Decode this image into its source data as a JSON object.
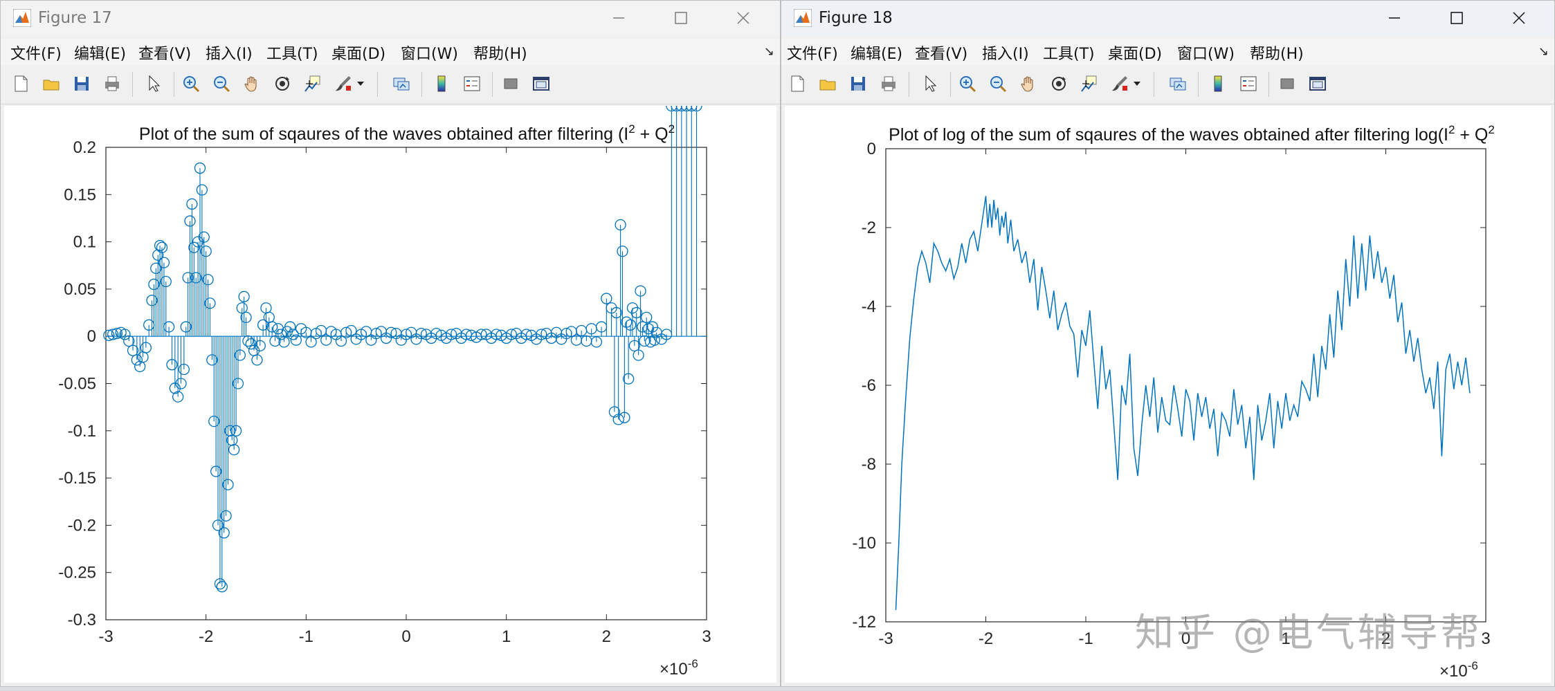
{
  "figure17": {
    "title": "Figure 17",
    "menu": [
      "文件(F)",
      "编辑(E)",
      "查看(V)",
      "插入(I)",
      "工具(T)",
      "桌面(D)",
      "窗口(W)",
      "帮助(H)"
    ],
    "chart_data": {
      "type": "stem",
      "title_main": "Plot of the sum of sqaures of the waves obtained after filtering (I",
      "title_sup1": "2",
      "title_mid": " + Q",
      "title_sup2": "2",
      "xlim": [
        -3,
        3
      ],
      "ylim": [
        -0.3,
        0.2
      ],
      "xticks": [
        "-3",
        "-2",
        "-1",
        "0",
        "1",
        "2",
        "3"
      ],
      "yticks": [
        "0.2",
        "0.15",
        "0.1",
        "0.05",
        "0",
        "-0.05",
        "-0.1",
        "-0.15",
        "-0.2",
        "-0.25",
        "-0.3"
      ],
      "x_exponent_base": "×10",
      "x_exponent": "-6",
      "series_color": "#0072bd",
      "x": [
        -2.97,
        -2.93,
        -2.89,
        -2.85,
        -2.81,
        -2.77,
        -2.73,
        -2.69,
        -2.66,
        -2.63,
        -2.6,
        -2.57,
        -2.54,
        -2.52,
        -2.5,
        -2.48,
        -2.46,
        -2.44,
        -2.42,
        -2.4,
        -2.37,
        -2.34,
        -2.31,
        -2.28,
        -2.25,
        -2.22,
        -2.2,
        -2.18,
        -2.16,
        -2.14,
        -2.12,
        -2.1,
        -2.08,
        -2.06,
        -2.04,
        -2.02,
        -2.0,
        -1.98,
        -1.96,
        -1.94,
        -1.92,
        -1.9,
        -1.88,
        -1.86,
        -1.84,
        -1.82,
        -1.8,
        -1.78,
        -1.76,
        -1.74,
        -1.72,
        -1.7,
        -1.68,
        -1.66,
        -1.64,
        -1.62,
        -1.6,
        -1.58,
        -1.55,
        -1.52,
        -1.49,
        -1.46,
        -1.43,
        -1.4,
        -1.37,
        -1.34,
        -1.31,
        -1.28,
        -1.25,
        -1.22,
        -1.19,
        -1.16,
        -1.13,
        -1.1,
        -1.05,
        -1.0,
        -0.95,
        -0.9,
        -0.85,
        -0.8,
        -0.75,
        -0.7,
        -0.65,
        -0.6,
        -0.55,
        -0.5,
        -0.45,
        -0.4,
        -0.35,
        -0.3,
        -0.25,
        -0.2,
        -0.15,
        -0.1,
        -0.05,
        0.0,
        0.05,
        0.1,
        0.15,
        0.2,
        0.25,
        0.3,
        0.35,
        0.4,
        0.45,
        0.5,
        0.55,
        0.6,
        0.65,
        0.7,
        0.75,
        0.8,
        0.85,
        0.9,
        0.95,
        1.0,
        1.05,
        1.1,
        1.15,
        1.2,
        1.25,
        1.3,
        1.35,
        1.4,
        1.45,
        1.5,
        1.55,
        1.6,
        1.65,
        1.7,
        1.75,
        1.8,
        1.85,
        1.9,
        1.95,
        2.0,
        2.05,
        2.08,
        2.1,
        2.12,
        2.14,
        2.16,
        2.18,
        2.2,
        2.22,
        2.24,
        2.26,
        2.28,
        2.3,
        2.32,
        2.34,
        2.36,
        2.38,
        2.4,
        2.42,
        2.44,
        2.46,
        2.48,
        2.5,
        2.55,
        2.6,
        2.65,
        2.7,
        2.75,
        2.8,
        2.85,
        2.9
      ],
      "y": [
        0.001,
        0.002,
        0.003,
        0.004,
        0.002,
        -0.005,
        -0.015,
        -0.025,
        -0.032,
        -0.022,
        -0.012,
        0.012,
        0.038,
        0.055,
        0.072,
        0.086,
        0.096,
        0.094,
        0.078,
        0.058,
        0.01,
        -0.03,
        -0.055,
        -0.064,
        -0.05,
        -0.035,
        0.01,
        0.062,
        0.122,
        0.14,
        0.094,
        0.062,
        0.1,
        0.178,
        0.155,
        0.105,
        0.09,
        0.06,
        0.035,
        -0.025,
        -0.09,
        -0.143,
        -0.2,
        -0.262,
        -0.265,
        -0.208,
        -0.19,
        -0.157,
        -0.1,
        -0.11,
        -0.12,
        -0.1,
        -0.05,
        -0.02,
        0.03,
        0.042,
        0.02,
        -0.005,
        -0.008,
        -0.015,
        -0.025,
        -0.01,
        0.012,
        0.03,
        0.02,
        0.01,
        -0.005,
        0.008,
        0.002,
        -0.006,
        0.005,
        0.01,
        0.002,
        -0.004,
        0.008,
        0.004,
        -0.006,
        0.003,
        0.006,
        -0.004,
        0.005,
        0.002,
        -0.005,
        0.004,
        0.006,
        -0.003,
        0.002,
        0.005,
        -0.004,
        0.003,
        0.005,
        -0.002,
        0.004,
        0.003,
        -0.004,
        0.002,
        0.004,
        -0.003,
        0.003,
        0.002,
        -0.002,
        0.003,
        0.001,
        -0.002,
        0.002,
        0.003,
        -0.002,
        0.002,
        0.001,
        -0.001,
        0.002,
        0.002,
        -0.002,
        0.002,
        0.001,
        -0.002,
        0.002,
        0.003,
        -0.002,
        0.002,
        0.001,
        -0.003,
        0.002,
        0.003,
        -0.002,
        0.004,
        -0.003,
        0.003,
        0.005,
        -0.004,
        0.006,
        -0.005,
        0.008,
        -0.006,
        0.01,
        0.04,
        0.03,
        -0.08,
        0.025,
        -0.088,
        0.118,
        0.09,
        -0.086,
        0.015,
        -0.045,
        0.012,
        0.03,
        -0.01,
        0.025,
        -0.02,
        0.048,
        0.01,
        -0.005,
        0.02,
        0.008,
        -0.006,
        0.01,
        -0.004,
        0.004,
        -0.003,
        0.002
      ],
      "y_axis_values": [
        0.2,
        0.15,
        0.1,
        0.05,
        0,
        -0.05,
        -0.1,
        -0.15,
        -0.2,
        -0.25,
        -0.3
      ],
      "x_axis_values": [
        -3,
        -2,
        -1,
        0,
        1,
        2,
        3
      ]
    }
  },
  "figure18": {
    "title": "Figure 18",
    "menu": [
      "文件(F)",
      "编辑(E)",
      "查看(V)",
      "插入(I)",
      "工具(T)",
      "桌面(D)",
      "窗口(W)",
      "帮助(H)"
    ],
    "chart_data": {
      "type": "line",
      "title_main": "Plot of log of the sum of sqaures of the waves obtained after filtering log(I",
      "title_sup1": "2",
      "title_mid": " + Q",
      "title_sup2": "2",
      "xlim": [
        -3,
        3
      ],
      "ylim": [
        -12,
        0
      ],
      "xticks": [
        "-3",
        "-2",
        "-1",
        "0",
        "1",
        "2",
        "3"
      ],
      "yticks": [
        "0",
        "-2",
        "-4",
        "-6",
        "-8",
        "-10",
        "-12"
      ],
      "x_exponent_base": "×10",
      "x_exponent": "-6",
      "series_color": "#0072bd",
      "x": [
        -2.9,
        -2.87,
        -2.84,
        -2.8,
        -2.76,
        -2.72,
        -2.68,
        -2.64,
        -2.6,
        -2.56,
        -2.52,
        -2.48,
        -2.44,
        -2.4,
        -2.36,
        -2.32,
        -2.28,
        -2.24,
        -2.2,
        -2.16,
        -2.12,
        -2.08,
        -2.04,
        -2.0,
        -1.98,
        -1.96,
        -1.94,
        -1.92,
        -1.9,
        -1.88,
        -1.86,
        -1.84,
        -1.82,
        -1.8,
        -1.78,
        -1.75,
        -1.72,
        -1.68,
        -1.64,
        -1.6,
        -1.56,
        -1.52,
        -1.48,
        -1.44,
        -1.4,
        -1.36,
        -1.32,
        -1.28,
        -1.24,
        -1.2,
        -1.16,
        -1.12,
        -1.08,
        -1.04,
        -1.0,
        -0.96,
        -0.92,
        -0.88,
        -0.84,
        -0.8,
        -0.76,
        -0.72,
        -0.68,
        -0.64,
        -0.6,
        -0.56,
        -0.52,
        -0.48,
        -0.44,
        -0.4,
        -0.36,
        -0.32,
        -0.28,
        -0.24,
        -0.2,
        -0.16,
        -0.12,
        -0.08,
        -0.04,
        0.0,
        0.04,
        0.08,
        0.12,
        0.16,
        0.2,
        0.24,
        0.28,
        0.32,
        0.36,
        0.4,
        0.44,
        0.48,
        0.52,
        0.56,
        0.6,
        0.64,
        0.68,
        0.72,
        0.76,
        0.8,
        0.84,
        0.88,
        0.92,
        0.96,
        1.0,
        1.04,
        1.08,
        1.12,
        1.16,
        1.2,
        1.24,
        1.28,
        1.32,
        1.36,
        1.4,
        1.44,
        1.48,
        1.52,
        1.56,
        1.6,
        1.64,
        1.68,
        1.72,
        1.76,
        1.8,
        1.84,
        1.88,
        1.92,
        1.96,
        2.0,
        2.04,
        2.08,
        2.12,
        2.16,
        2.2,
        2.24,
        2.28,
        2.32,
        2.36,
        2.4,
        2.44,
        2.48,
        2.52,
        2.56,
        2.6,
        2.64,
        2.68,
        2.72,
        2.76,
        2.8,
        2.84,
        2.88,
        2.92,
        2.96
      ],
      "y": [
        -11.7,
        -10.0,
        -8.0,
        -6.3,
        -4.8,
        -3.8,
        -3.0,
        -2.6,
        -2.9,
        -3.4,
        -2.4,
        -2.6,
        -2.9,
        -3.1,
        -2.8,
        -3.3,
        -3.0,
        -2.4,
        -2.9,
        -2.3,
        -2.1,
        -2.6,
        -1.9,
        -1.2,
        -2.0,
        -1.4,
        -2.0,
        -1.3,
        -1.8,
        -1.5,
        -2.2,
        -1.7,
        -2.0,
        -1.6,
        -2.4,
        -1.8,
        -2.6,
        -2.3,
        -2.9,
        -2.6,
        -3.4,
        -2.8,
        -4.1,
        -3.0,
        -3.6,
        -4.3,
        -3.6,
        -4.6,
        -4.2,
        -3.9,
        -4.5,
        -4.7,
        -5.8,
        -4.6,
        -5.0,
        -4.1,
        -5.4,
        -6.6,
        -5.0,
        -6.1,
        -5.6,
        -7.0,
        -8.4,
        -6.0,
        -6.5,
        -5.2,
        -7.6,
        -8.3,
        -7.0,
        -6.0,
        -6.8,
        -5.8,
        -7.2,
        -6.3,
        -6.9,
        -7.0,
        -6.0,
        -6.6,
        -7.3,
        -6.1,
        -6.4,
        -7.4,
        -6.2,
        -6.8,
        -6.3,
        -7.1,
        -6.6,
        -7.8,
        -6.7,
        -6.9,
        -7.3,
        -6.1,
        -7.0,
        -6.5,
        -7.6,
        -6.8,
        -8.4,
        -6.5,
        -7.4,
        -6.9,
        -6.2,
        -7.6,
        -6.4,
        -7.1,
        -6.2,
        -6.9,
        -6.5,
        -6.8,
        -5.9,
        -6.1,
        -6.4,
        -5.2,
        -6.3,
        -5.0,
        -5.6,
        -4.2,
        -5.3,
        -3.6,
        -4.6,
        -2.8,
        -4.0,
        -2.2,
        -3.8,
        -2.4,
        -3.6,
        -2.2,
        -3.3,
        -2.6,
        -3.4,
        -3.0,
        -3.8,
        -3.2,
        -4.4,
        -3.9,
        -5.2,
        -4.6,
        -5.4,
        -4.8,
        -5.6,
        -6.2,
        -5.8,
        -6.6,
        -5.4,
        -7.8,
        -5.6,
        -5.2,
        -6.1,
        -5.4,
        -6.0,
        -5.3,
        -6.2
      ]
    }
  },
  "watermark": "知乎 @电气辅导帮"
}
